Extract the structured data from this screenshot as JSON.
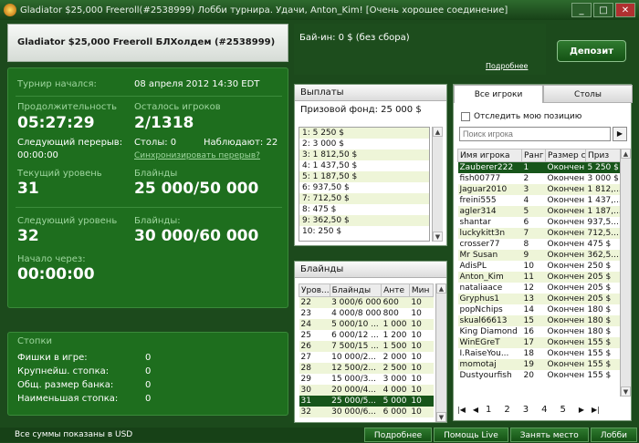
{
  "window": {
    "title": "Gladiator $25,000 Freeroll(#2538999) Лобби турнира. Удачи, Anton_Kim!   [Очень хорошее соединение]",
    "min_label": "_",
    "max_label": "□",
    "close_label": "✕"
  },
  "header": {
    "tournament_name": "Gladiator $25,000 Freeroll БЛХолдем (#2538999)",
    "buyin": "Бай-ин: 0 $ (без сбора)",
    "more_link": "Подробнее",
    "deposit_label": "Депозит"
  },
  "info": {
    "started_label": "Турнир начался:",
    "started_value": "08 апреля 2012  14:30 EDT",
    "duration_label": "Продолжительность",
    "duration_value": "05:27:29",
    "players_left_label": "Осталось игроков",
    "players_left_value": "2/1318",
    "next_break_label": "Следующий перерыв:",
    "next_break_value": "00:00:00",
    "tables_label": "Столы: 0",
    "observers_label": "Наблюдают: 22",
    "sync_link": "Синхронизировать перерыв?",
    "current_level_label": "Текущий уровень",
    "current_level_value": "31",
    "blinds_label": "Блайнды",
    "current_blinds_value": "25 000/50 000",
    "next_level_label": "Следующий уровень",
    "next_level_value": "32",
    "next_blinds_label": "Блайнды:",
    "next_blinds_value": "30 000/60 000",
    "start_in_label": "Начало через:",
    "start_in_value": "00:00:00"
  },
  "stacks": {
    "title": "Стопки",
    "rows": [
      {
        "label": "Фишки в игре:",
        "value": "0"
      },
      {
        "label": "Крупнейш. стопка:",
        "value": "0"
      },
      {
        "label": "Общ. размер банка:",
        "value": "0"
      },
      {
        "label": "Наименьшая стопка:",
        "value": "0"
      }
    ]
  },
  "payouts": {
    "title": "Выплаты",
    "prize_fund": "Призовой фонд: 25 000 $",
    "items": [
      "1: 5 250 $",
      "2: 3 000 $",
      "3: 1 812,50 $",
      "4: 1 437,50 $",
      "5: 1 187,50 $",
      "6: 937,50 $",
      "7: 712,50 $",
      "8: 475 $",
      "9: 362,50 $",
      "10: 250 $"
    ]
  },
  "blinds": {
    "title": "Блайнды",
    "columns": [
      "Уров...",
      "Блайнды",
      "Анте",
      "Мин"
    ],
    "rows": [
      [
        "22",
        "3 000/6 000",
        "600",
        "10"
      ],
      [
        "23",
        "4 000/8 000",
        "800",
        "10"
      ],
      [
        "24",
        "5 000/10 ...",
        "1 000",
        "10"
      ],
      [
        "25",
        "6 000/12 ...",
        "1 200",
        "10"
      ],
      [
        "26",
        "7 500/15 ...",
        "1 500",
        "10"
      ],
      [
        "27",
        "10 000/2...",
        "2 000",
        "10"
      ],
      [
        "28",
        "12 500/2...",
        "2 500",
        "10"
      ],
      [
        "29",
        "15 000/3...",
        "3 000",
        "10"
      ],
      [
        "30",
        "20 000/4...",
        "4 000",
        "10"
      ],
      [
        "31",
        "25 000/5...",
        "5 000",
        "10"
      ],
      [
        "32",
        "30 000/6...",
        "6 000",
        "10"
      ]
    ]
  },
  "players": {
    "tab_all": "Все игроки",
    "tab_tables": "Столы",
    "track_label": "Отследить мою позицию",
    "search_placeholder": "Поиск игрока",
    "columns": [
      "Имя игрока",
      "Ранг",
      "Размер с...",
      "Приз"
    ],
    "rows": [
      [
        "Zauberer222",
        "1",
        "Окончен",
        "5 250 $"
      ],
      [
        "fish00777",
        "2",
        "Окончен",
        "3 000 $"
      ],
      [
        "Jaguar2010",
        "3",
        "Окончен",
        "1 812,..."
      ],
      [
        "freini555",
        "4",
        "Окончен",
        "1 437,..."
      ],
      [
        "agler314",
        "5",
        "Окончен",
        "1 187,..."
      ],
      [
        "shantar",
        "6",
        "Окончен",
        "937,5..."
      ],
      [
        "luckykitt3n",
        "7",
        "Окончен",
        "712,5..."
      ],
      [
        "crosser77",
        "8",
        "Окончен",
        "475 $"
      ],
      [
        "Mr Susan",
        "9",
        "Окончен",
        "362,5..."
      ],
      [
        "AdisPL",
        "10",
        "Окончен",
        "250 $"
      ],
      [
        "Anton_Kim",
        "11",
        "Окончен",
        "205 $"
      ],
      [
        "nataliaace",
        "12",
        "Окончен",
        "205 $"
      ],
      [
        "Gryphus1",
        "13",
        "Окончен",
        "205 $"
      ],
      [
        "popNchips",
        "14",
        "Окончен",
        "180 $"
      ],
      [
        "skual66613",
        "15",
        "Окончен",
        "180 $"
      ],
      [
        "King Diamond",
        "16",
        "Окончен",
        "180 $"
      ],
      [
        "WinEGreT",
        "17",
        "Окончен",
        "155 $"
      ],
      [
        "I.RaiseYou...",
        "18",
        "Окончен",
        "155 $"
      ],
      [
        "momotaj",
        "19",
        "Окончен",
        "155 $"
      ],
      [
        "Dustyourfish",
        "20",
        "Окончен",
        "155 $"
      ]
    ],
    "pages": [
      "1",
      "2",
      "3",
      "4",
      "5"
    ]
  },
  "status": {
    "text": "Все суммы показаны в USD",
    "buttons": [
      "Подробнее",
      "Помощь Live",
      "Занять место",
      "Лобби"
    ]
  }
}
